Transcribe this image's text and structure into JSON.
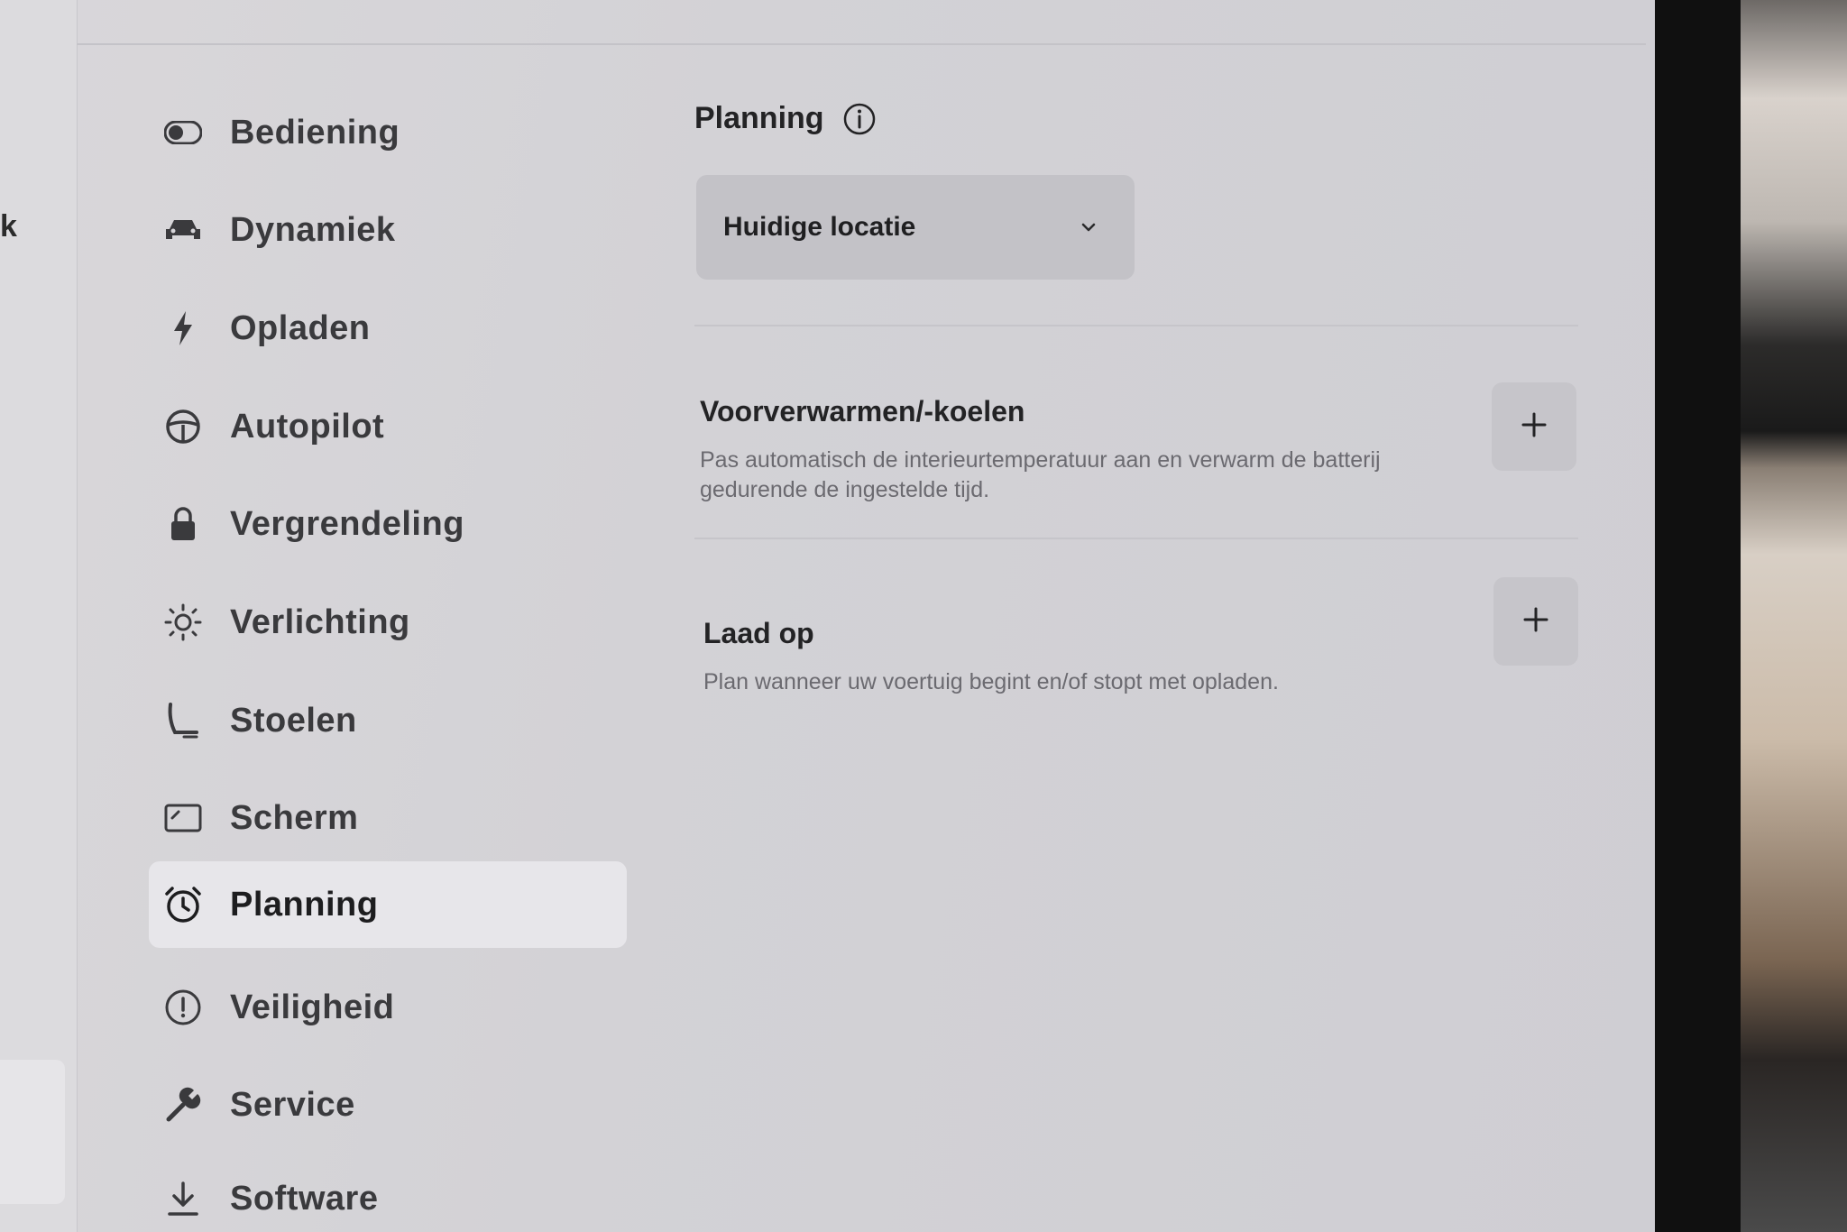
{
  "left_strip": {
    "text": "k"
  },
  "sidebar": {
    "items": [
      {
        "label": "Bediening",
        "icon": "toggle-icon",
        "active": false
      },
      {
        "label": "Dynamiek",
        "icon": "car-icon",
        "active": false
      },
      {
        "label": "Opladen",
        "icon": "lightning-bolt-icon",
        "active": false
      },
      {
        "label": "Autopilot",
        "icon": "steering-wheel-icon",
        "active": false
      },
      {
        "label": "Vergrendeling",
        "icon": "lock-icon",
        "active": false
      },
      {
        "label": "Verlichting",
        "icon": "light-bulb-icon",
        "active": false
      },
      {
        "label": "Stoelen",
        "icon": "seat-icon",
        "active": false
      },
      {
        "label": "Scherm",
        "icon": "screen-icon",
        "active": false
      },
      {
        "label": "Planning",
        "icon": "alarm-clock-icon",
        "active": true
      },
      {
        "label": "Veiligheid",
        "icon": "alert-circle-icon",
        "active": false
      },
      {
        "label": "Service",
        "icon": "wrench-icon",
        "active": false
      },
      {
        "label": "Software",
        "icon": "download-icon",
        "active": false
      }
    ]
  },
  "main": {
    "title": "Planning",
    "location_dropdown": {
      "value": "Huidige locatie"
    },
    "sections": [
      {
        "title": "Voorverwarmen/-koelen",
        "description": "Pas automatisch de interieurtemperatuur aan en verwarm de batterij gedurende de ingestelde tijd."
      },
      {
        "title": "Laad op",
        "description": "Plan wanneer uw voertuig begint en/of stopt met opladen."
      }
    ]
  },
  "colors": {
    "screen_bg": "#d5d4d8",
    "active_item_bg": "#e7e6ea",
    "button_bg": "#c6c5ca",
    "text_primary": "#232325",
    "text_secondary": "#6b6a70"
  }
}
